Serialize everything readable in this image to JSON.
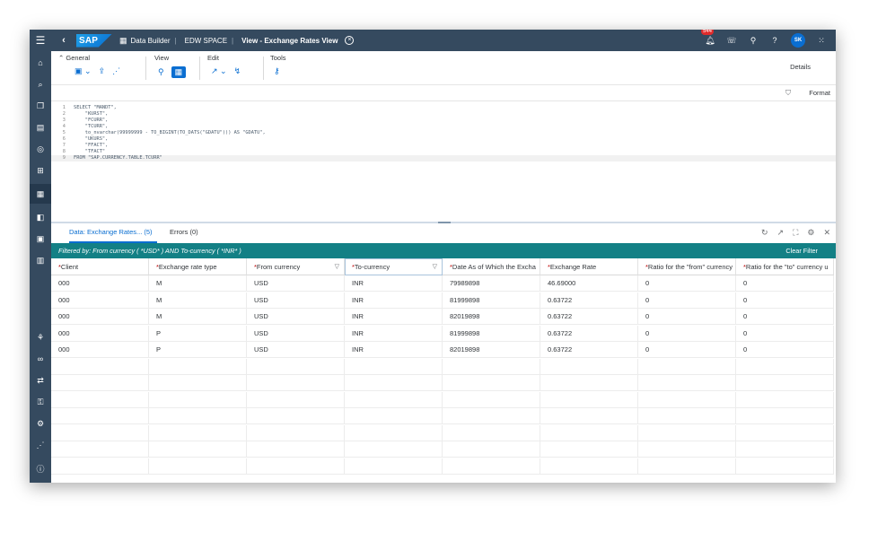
{
  "shell": {
    "app_name": "Data Builder",
    "space": "EDW SPACE",
    "view_title": "View - Exchange Rates View",
    "notification_count": "544",
    "user_initials": "SK",
    "logo_text": "SAP"
  },
  "toolbar": {
    "general_label": "General",
    "view_label": "View",
    "edit_label": "Edit",
    "tools_label": "Tools",
    "details_label": "Details",
    "format_label": "Format"
  },
  "editor": {
    "lines": [
      {
        "n": "1",
        "text": "SELECT \"MANDT\","
      },
      {
        "n": "2",
        "text": "    \"KURST\","
      },
      {
        "n": "3",
        "text": "    \"FCURR\","
      },
      {
        "n": "4",
        "text": "    \"TCURR\","
      },
      {
        "n": "5",
        "text": "    to_nvarchar(99999999 - TO_BIGINT(TO_DATS(\"GDATU\"))) AS \"GDATU\","
      },
      {
        "n": "6",
        "text": "    \"UKURS\","
      },
      {
        "n": "7",
        "text": "    \"FFACT\","
      },
      {
        "n": "8",
        "text": "    \"TFACT\""
      },
      {
        "n": "9",
        "text": "FROM \"SAP.CURRENCY.TABLE.TCURR\""
      }
    ]
  },
  "panel": {
    "tab_data": "Data: Exchange Rates... (5)",
    "tab_errors": "Errors (0)",
    "filter_text": "Filtered by: From currency ( *USD* ) AND To-currency ( *INR* )",
    "clear_filter": "Clear Filter"
  },
  "table": {
    "columns": [
      {
        "label": "Client",
        "required": "*"
      },
      {
        "label": "Exchange rate type",
        "required": "*"
      },
      {
        "label": "From currency",
        "required": "*"
      },
      {
        "label": "To-currency",
        "required": "*"
      },
      {
        "label": "Date As of Which the Excha",
        "required": "*"
      },
      {
        "label": "Exchange Rate",
        "required": "*"
      },
      {
        "label": "Ratio for the \"from\" currency",
        "required": "*"
      },
      {
        "label": "Ratio for the \"to\" currency u",
        "required": "*"
      }
    ],
    "rows": [
      [
        "000",
        "M",
        "USD",
        "INR",
        "79989898",
        "46.69000",
        "0",
        "0"
      ],
      [
        "000",
        "M",
        "USD",
        "INR",
        "81999898",
        "0.63722",
        "0",
        "0"
      ],
      [
        "000",
        "M",
        "USD",
        "INR",
        "82019898",
        "0.63722",
        "0",
        "0"
      ],
      [
        "000",
        "P",
        "USD",
        "INR",
        "81999898",
        "0.63722",
        "0",
        "0"
      ],
      [
        "000",
        "P",
        "USD",
        "INR",
        "82019898",
        "0.63722",
        "0",
        "0"
      ]
    ],
    "empty_rows": 7
  },
  "icons": {
    "sidenav": [
      "menu-icon",
      "home-icon",
      "search-icon",
      "repository-icon",
      "data-builder-icon",
      "business-builder-icon",
      "data-flow-icon",
      "catalog-icon",
      "data-access-icon",
      "analytics-icon",
      "space-management-icon",
      "data-integration-icon",
      "connections-icon",
      "security-icon",
      "transport-icon",
      "system-icon",
      "info-icon"
    ]
  },
  "colors": {
    "shell": "#354a5f",
    "accent": "#0a6ed1",
    "filter_bar": "#138085",
    "required": "#bb0000"
  }
}
